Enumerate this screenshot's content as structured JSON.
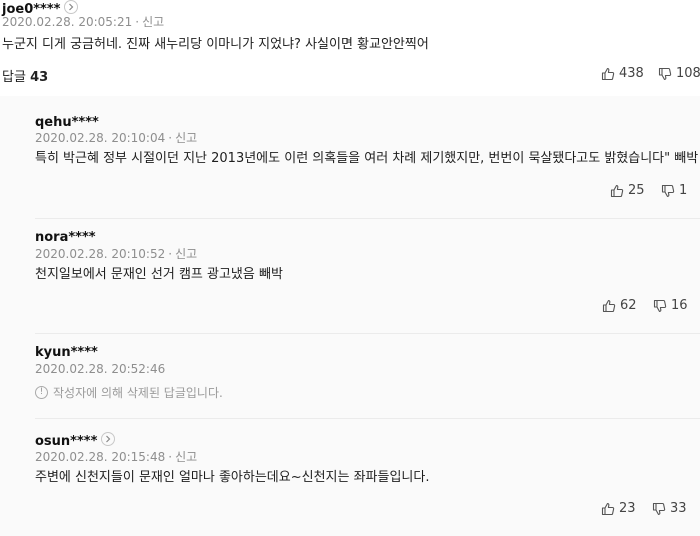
{
  "main_comment": {
    "user": "joe0****",
    "datetime": "2020.02.28. 20:05:21",
    "report": "신고",
    "text": "누군지 디게 궁금허네. 진짜 새누리당 이마니가 지었냐? 사실이면 황교안안찍어",
    "reply_label": "답글",
    "reply_count": "43",
    "likes": "438",
    "dislikes": "108"
  },
  "replies": [
    {
      "user": "qehu****",
      "datetime": "2020.02.28. 20:10:04",
      "report": "신고",
      "text": "특히 박근혜 정부 시절이던 지난 2013년에도 이런 의혹들을 여러 차례 제기했지만, 번번이 묵살됐다고도 밝혔습니다\" 빼박",
      "likes": "25",
      "dislikes": "1"
    },
    {
      "user": "nora****",
      "datetime": "2020.02.28. 20:10:52",
      "report": "신고",
      "text": "천지일보에서 문재인 선거 캠프 광고냈음 빼박",
      "likes": "62",
      "dislikes": "16"
    },
    {
      "user": "kyun****",
      "datetime": "2020.02.28. 20:52:46",
      "deleted_text": "작성자에 의해 삭제된 답글입니다."
    },
    {
      "user": "osun****",
      "datetime": "2020.02.28. 20:15:48",
      "report": "신고",
      "text": "주변에 신천지들이 문재인 얼마나 좋아하는데요~신천지는 좌파들입니다.",
      "likes": "23",
      "dislikes": "33"
    }
  ],
  "icons": {
    "like": "thumbs-up-icon",
    "dislike": "thumbs-down-icon",
    "profile": "chevron-right-icon",
    "deleted": "info-icon"
  }
}
